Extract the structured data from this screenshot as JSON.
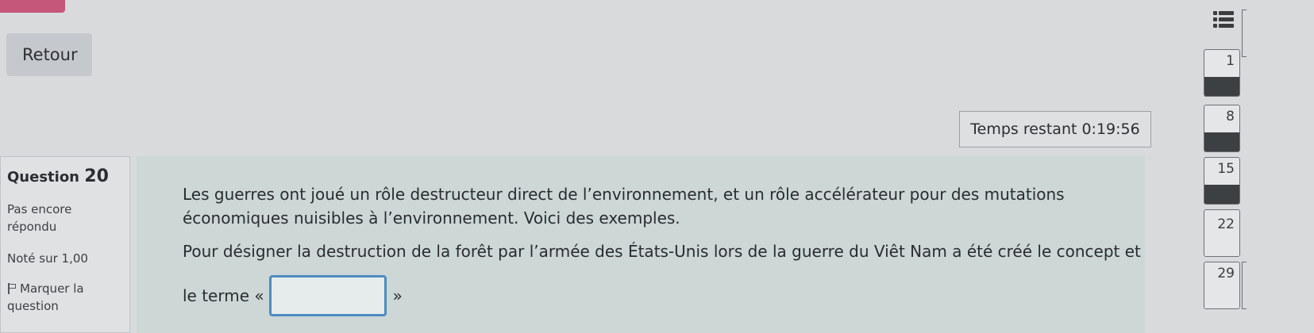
{
  "header": {
    "back_label": "Retour"
  },
  "timer": {
    "label": "Temps restant",
    "value": "0:19:56"
  },
  "question_info": {
    "title_prefix": "Question",
    "number": "20",
    "status": "Pas encore répondu",
    "grade": "Noté sur 1,00",
    "flag_label": "Marquer la question"
  },
  "question": {
    "intro": "Les guerres ont joué un rôle destructeur direct de l’environnement, et un rôle accélérateur pour des mutations économiques nuisibles à l’environnement. Voici des exemples.",
    "sentence": "Pour désigner la destruction de la forêt par l’armée des États-Unis lors de la guerre du Viêt Nam a été créé le concept et",
    "blank_before": "le terme «",
    "blank_after": "»",
    "answer_value": ""
  },
  "navigation": {
    "buttons": [
      {
        "label": "1",
        "answered": true
      },
      {
        "label": "8",
        "answered": true
      },
      {
        "label": "15",
        "answered": true
      },
      {
        "label": "22",
        "answered": false
      },
      {
        "label": "29",
        "answered": false
      }
    ]
  },
  "colors": {
    "accent": "#c4577a",
    "input_border": "#4d8bc0",
    "content_bg": "#ccd7d6"
  }
}
